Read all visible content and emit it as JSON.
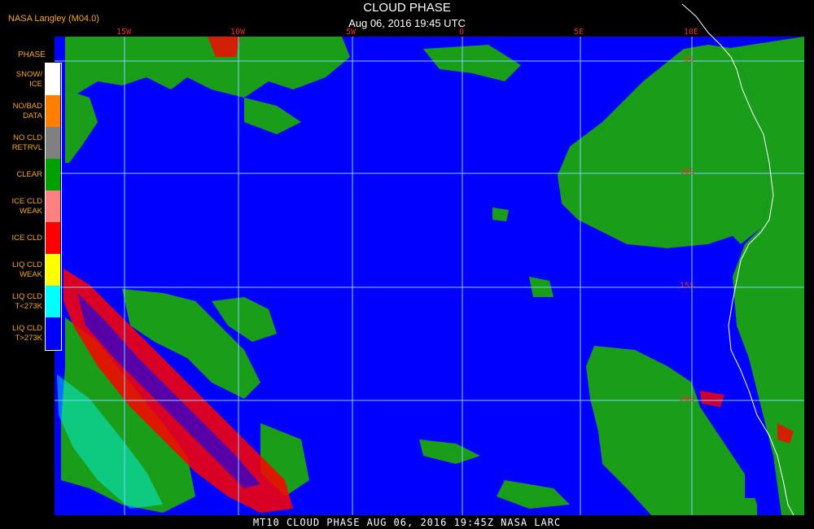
{
  "header": {
    "credit": "NASA Langley (M04.0)",
    "title": "CLOUD PHASE",
    "subtitle": "Aug 06, 2016 19:45 UTC"
  },
  "footer": {
    "caption": "MT10  CLOUD PHASE   AUG 06, 2016 19:45Z   NASA LARC"
  },
  "legend": {
    "header": "PHASE",
    "items": [
      {
        "label": "SNOW/\nICE",
        "color": "#ffffff"
      },
      {
        "label": "NO/BAD\nDATA",
        "color": "#ff8000"
      },
      {
        "label": "NO CLD\nRETRVL",
        "color": "#808080"
      },
      {
        "label": "CLEAR",
        "color": "#00a000"
      },
      {
        "label": "ICE CLD\nWEAK",
        "color": "#ff8080"
      },
      {
        "label": "ICE CLD",
        "color": "#ff0000"
      },
      {
        "label": "LIQ CLD\nWEAK",
        "color": "#ffff00"
      },
      {
        "label": "LIQ CLD\nT<273K",
        "color": "#00ffff"
      },
      {
        "label": "LIQ CLD\nT>273K",
        "color": "#0000ff"
      }
    ]
  },
  "map": {
    "longitude_labels": [
      "15W",
      "10W",
      "5W",
      "0",
      "5E",
      "10E"
    ],
    "latitude_labels": [
      "5S",
      "10S",
      "15S",
      "20S"
    ],
    "colors": {
      "ocean_liq_cloud": "#0000ff",
      "clear": "#1a9e1a",
      "ice_cloud": "#ff0000",
      "liq_cold": "#00ffff",
      "grid": "#7fd0ff",
      "coastline": "#ffffff"
    }
  }
}
